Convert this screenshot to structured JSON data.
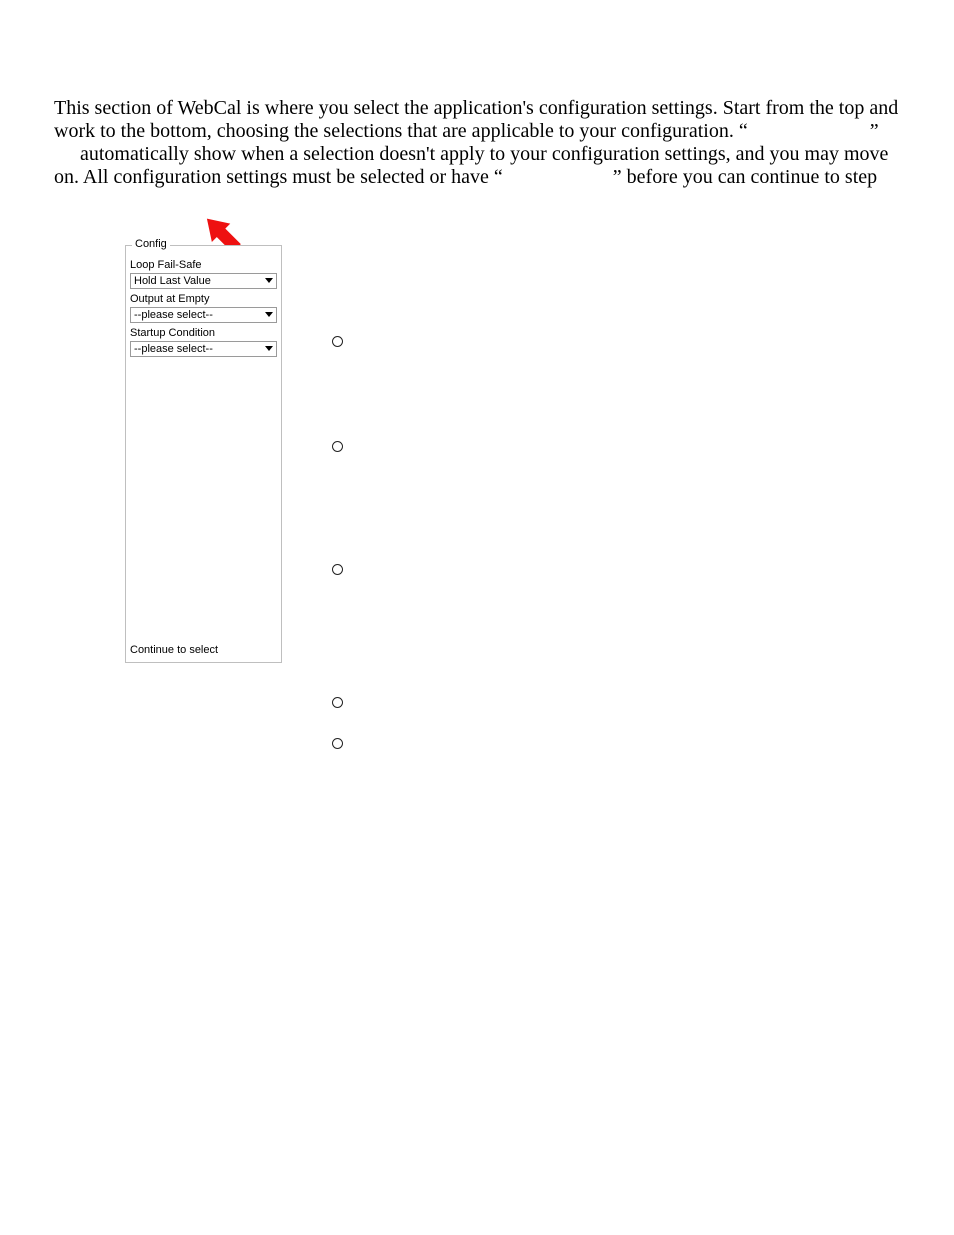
{
  "paragraph": {
    "t1": "This section of WebCal is where you select the application's configuration settings.  Start from the top and work to the bottom, choosing the selections that are applicable to your configuration.  “",
    "t2": "”",
    "t3": "automatically show when a selection doesn't apply to your configuration settings, and you may move on.  All configuration settings must be selected or have “",
    "t4": "” before you can continue to step"
  },
  "config": {
    "legend": "Config",
    "label_loop": "Loop Fail-Safe",
    "select_loop": "Hold Last Value",
    "label_output": "Output at Empty",
    "select_output": "--please select--",
    "label_startup": "Startup Condition",
    "select_startup": "--please select--",
    "footer": "Continue to select"
  }
}
